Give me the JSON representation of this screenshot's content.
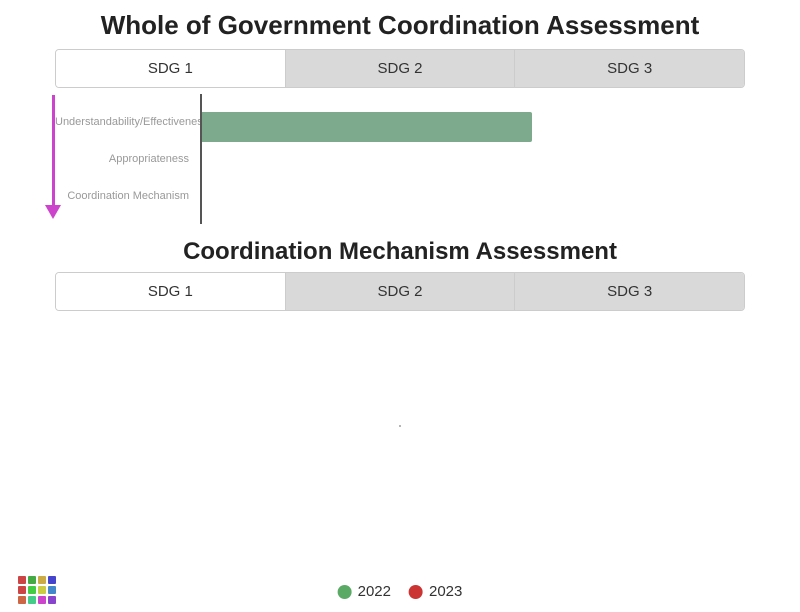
{
  "page": {
    "main_title": "Whole of Government Coordination Assessment",
    "section1": {
      "tabs": [
        {
          "label": "SDG 1",
          "state": "active"
        },
        {
          "label": "SDG 2",
          "state": "inactive"
        },
        {
          "label": "SDG 3",
          "state": "inactive"
        }
      ],
      "y_labels": [
        "Coordination Mechanism",
        "Appropriateness",
        "Understandability/Effectiveness"
      ],
      "bar_width_percent": 55
    },
    "section2": {
      "title": "Coordination Mechanism Assessment",
      "tabs": [
        {
          "label": "SDG 1",
          "state": "active"
        },
        {
          "label": "SDG 2",
          "state": "inactive"
        },
        {
          "label": "SDG 3",
          "state": "inactive"
        }
      ],
      "dot": "."
    },
    "legend": {
      "items": [
        {
          "label": "2022",
          "color": "green"
        },
        {
          "label": "2023",
          "color": "red"
        }
      ]
    },
    "grid_colors": [
      "#cc4444",
      "#44aa44",
      "#ccaa44",
      "#4444cc",
      "#cc4444",
      "#44cc44",
      "#cccc44",
      "#4488cc",
      "#cc6644",
      "#44cc88",
      "#cc44cc",
      "#8844cc"
    ]
  }
}
